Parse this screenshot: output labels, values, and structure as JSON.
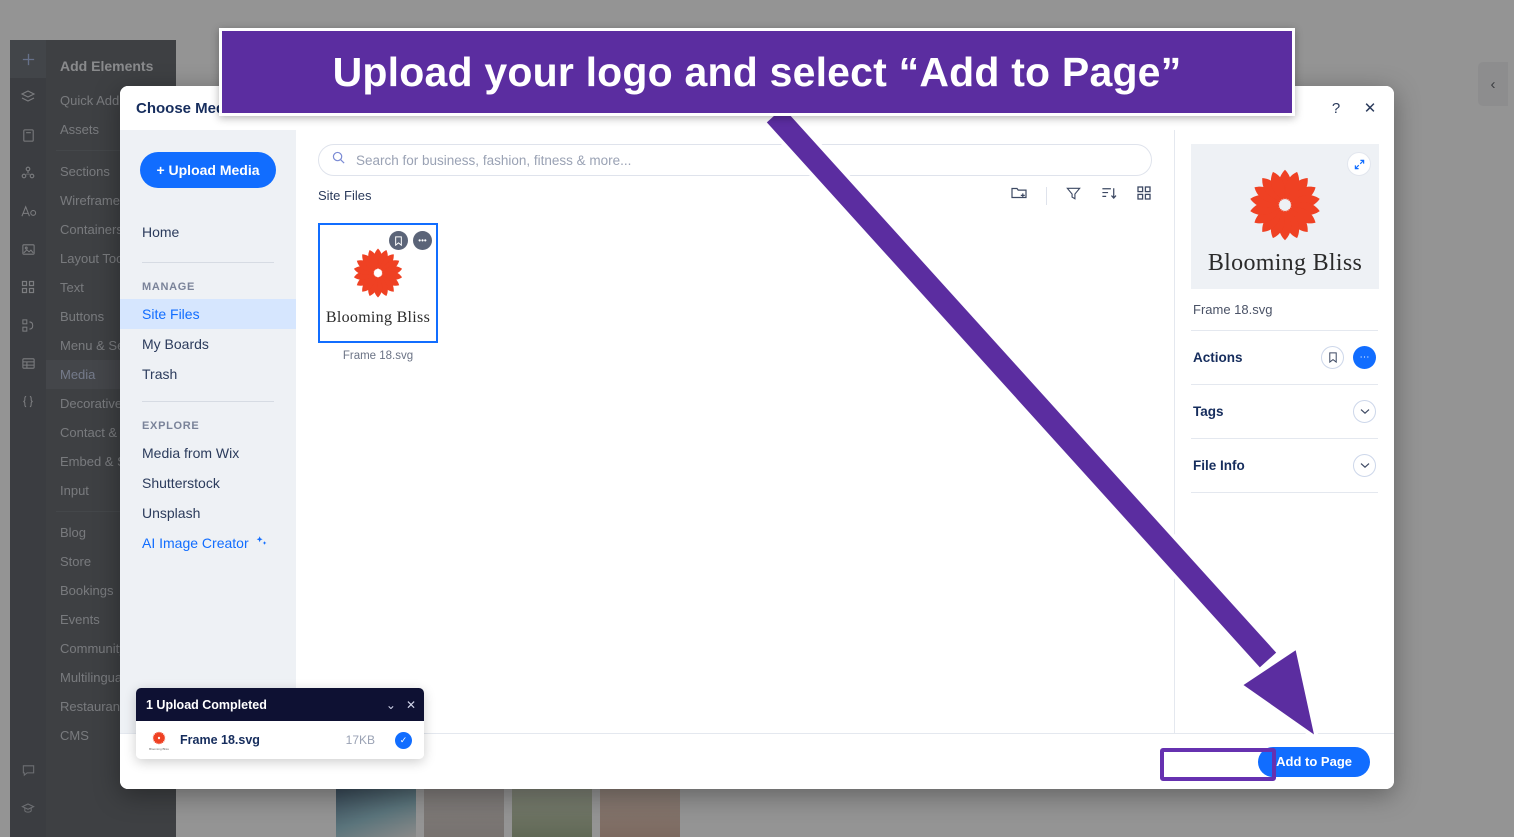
{
  "annotation": {
    "banner_text": "Upload your logo and select “Add to Page”",
    "banner_bg": "#5b2da0",
    "arrow_color": "#5b2da0",
    "highlight_color": "#6631b0"
  },
  "editor": {
    "rail_icons": [
      {
        "name": "add-plus-icon",
        "glyph": "+",
        "active": true
      },
      {
        "name": "layers-icon",
        "glyph": "◇",
        "active": false
      },
      {
        "name": "pages-icon",
        "glyph": "▤",
        "active": false
      },
      {
        "name": "site-structure-icon",
        "glyph": "⑂",
        "active": false
      },
      {
        "name": "theme-text-icon",
        "glyph": "A○",
        "active": false
      },
      {
        "name": "media-image-icon",
        "glyph": "⛰",
        "active": false
      },
      {
        "name": "apps-icon",
        "glyph": "⌸",
        "active": false
      },
      {
        "name": "interactions-icon",
        "glyph": "⧉",
        "active": false
      },
      {
        "name": "cms-table-icon",
        "glyph": "▦",
        "active": false
      },
      {
        "name": "dev-mode-icon",
        "glyph": "{ }",
        "active": false
      }
    ],
    "bottom_rail_icons": [
      {
        "name": "chat-icon",
        "glyph": "▭"
      },
      {
        "name": "help-academy-icon",
        "glyph": "⌂"
      }
    ],
    "panel_title": "Add Elements",
    "panel_items": [
      {
        "label": "Quick Add",
        "active": false,
        "sep_after": false
      },
      {
        "label": "Assets",
        "active": false,
        "sep_after": true
      },
      {
        "label": "Sections",
        "active": false,
        "sep_after": false
      },
      {
        "label": "Wireframes",
        "active": false,
        "sep_after": false
      },
      {
        "label": "Containers",
        "active": false,
        "sep_after": false
      },
      {
        "label": "Layout Tools",
        "active": false,
        "sep_after": false
      },
      {
        "label": "Text",
        "active": false,
        "sep_after": false
      },
      {
        "label": "Buttons",
        "active": false,
        "sep_after": false
      },
      {
        "label": "Menu & Search",
        "active": false,
        "sep_after": false
      },
      {
        "label": "Media",
        "active": true,
        "sep_after": false
      },
      {
        "label": "Decorative",
        "active": false,
        "sep_after": false
      },
      {
        "label": "Contact & Forms",
        "active": false,
        "sep_after": false
      },
      {
        "label": "Embed & Social",
        "active": false,
        "sep_after": false
      },
      {
        "label": "Input",
        "active": false,
        "sep_after": true
      },
      {
        "label": "Blog",
        "active": false,
        "sep_after": false
      },
      {
        "label": "Store",
        "active": false,
        "sep_after": false
      },
      {
        "label": "Bookings",
        "active": false,
        "sep_after": false
      },
      {
        "label": "Events",
        "active": false,
        "sep_after": false
      },
      {
        "label": "Community",
        "active": false,
        "sep_after": false
      },
      {
        "label": "Multilingual",
        "active": false,
        "sep_after": false
      },
      {
        "label": "Restaurants",
        "active": false,
        "sep_after": false
      },
      {
        "label": "CMS",
        "active": false,
        "sep_after": false
      }
    ],
    "collapse_icon": "‹"
  },
  "modal": {
    "title": "Choose Media",
    "help_icon": "?",
    "close_icon": "✕",
    "nav": {
      "upload_button": "+ Upload Media",
      "home": "Home",
      "manage_label": "MANAGE",
      "manage_items": [
        {
          "label": "Site Files",
          "active": true
        },
        {
          "label": "My Boards",
          "active": false
        },
        {
          "label": "Trash",
          "active": false
        }
      ],
      "explore_label": "EXPLORE",
      "explore_items": [
        {
          "label": "Media from Wix",
          "link": false
        },
        {
          "label": "Shutterstock",
          "link": false
        },
        {
          "label": "Unsplash",
          "link": false
        },
        {
          "label": "AI Image Creator",
          "link": true
        }
      ]
    },
    "search": {
      "placeholder": "Search for business, fashion, fitness & more...",
      "value": ""
    },
    "breadcrumb": "Site Files",
    "tools": [
      {
        "name": "new-folder-icon"
      },
      {
        "name": "filter-icon"
      },
      {
        "name": "sort-icon"
      },
      {
        "name": "grid-view-icon"
      }
    ],
    "files": [
      {
        "name": "Frame 18.svg",
        "wordmark": "Blooming Bliss",
        "selected": true,
        "badges": [
          {
            "name": "save-to-board-icon",
            "glyph": "☐"
          },
          {
            "name": "more-options-icon",
            "glyph": "•••"
          }
        ]
      }
    ],
    "info_panel": {
      "preview_wordmark": "Blooming Bliss",
      "expand_icon": "⤢",
      "filename": "Frame 18.svg",
      "rows": [
        {
          "label": "Actions",
          "controls": [
            "bookmark-outline",
            "more-filled"
          ]
        },
        {
          "label": "Tags",
          "controls": [
            "chevron-down-outline"
          ]
        },
        {
          "label": "File Info",
          "controls": [
            "chevron-down-outline"
          ]
        }
      ]
    },
    "footer": {
      "add_to_page": "Add to Page"
    }
  },
  "upload_toast": {
    "title": "1 Upload Completed",
    "collapse_icon": "⌄",
    "close_icon": "✕",
    "file_name": "Frame 18.svg",
    "file_size": "17KB",
    "status_icon": "✓",
    "thumb_label": "Blooming Bliss"
  },
  "colors": {
    "accent_blue": "#116dff",
    "logo_orange": "#ef4123",
    "dark_navy": "#0e1133",
    "purple": "#5b2da0"
  }
}
